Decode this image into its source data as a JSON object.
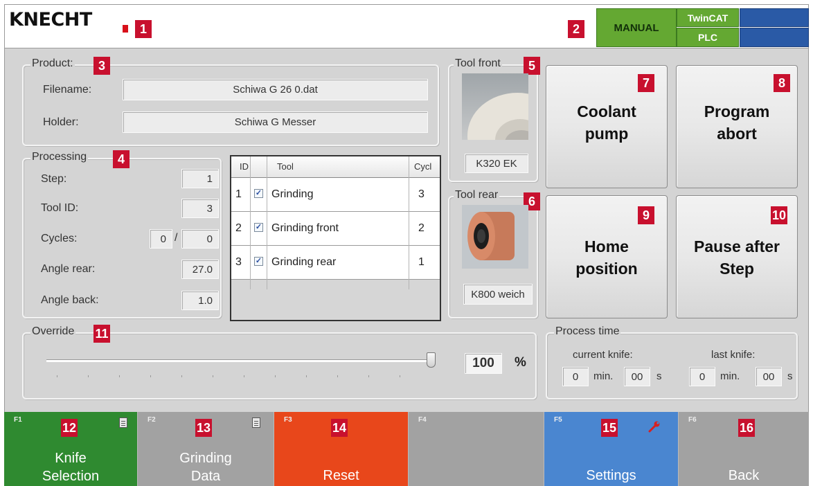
{
  "header": {
    "logo": "KNECHT",
    "mode": "MANUAL",
    "runtime": "TwinCAT",
    "controller": "PLC",
    "colors": {
      "ok": "#64a832",
      "status_blue": "#2a5aa6",
      "marker": "#c8102e"
    }
  },
  "markers": [
    "1",
    "2",
    "3",
    "4",
    "5",
    "6",
    "7",
    "8",
    "9",
    "10",
    "11",
    "12",
    "13",
    "14",
    "15",
    "16"
  ],
  "product": {
    "legend": "Product:",
    "filename_label": "Filename:",
    "filename_value": "Schiwa G 26 0.dat",
    "holder_label": "Holder:",
    "holder_value": "Schiwa G Messer"
  },
  "processing": {
    "legend": "Processing",
    "step_label": "Step:",
    "step_value": "1",
    "tool_id_label": "Tool ID:",
    "tool_id_value": "3",
    "cycles_label": "Cycles:",
    "cycles_current": "0",
    "cycles_sep": "/",
    "cycles_total": "0",
    "angle_rear_label": "Angle rear:",
    "angle_rear_value": "27.0",
    "angle_back_label": "Angle back:",
    "angle_back_value": "1.0"
  },
  "tool_table": {
    "headers": [
      "ID",
      "Tool",
      "Cycl"
    ],
    "rows": [
      {
        "id": "1",
        "checked": true,
        "tool": "Grinding",
        "cycles": "3"
      },
      {
        "id": "2",
        "checked": true,
        "tool": "Grinding front",
        "cycles": "2"
      },
      {
        "id": "3",
        "checked": true,
        "tool": "Grinding rear",
        "cycles": "1"
      }
    ]
  },
  "tool_front": {
    "legend": "Tool front",
    "name": "K320 EK"
  },
  "tool_rear": {
    "legend": "Tool rear",
    "name": "K800 weich"
  },
  "buttons": {
    "coolant_l1": "Coolant",
    "coolant_l2": "pump",
    "abort_l1": "Program",
    "abort_l2": "abort",
    "home_l1": "Home",
    "home_l2": "position",
    "pause_l1": "Pause after",
    "pause_l2": "Step"
  },
  "override": {
    "legend": "Override",
    "value": "100",
    "unit": "%",
    "level": 1.0
  },
  "process_time": {
    "legend": "Process time",
    "current_label": "current knife:",
    "last_label": "last knife:",
    "current_min": "0",
    "current_sec": "00",
    "last_min": "0",
    "last_sec": "00",
    "min_unit": "min.",
    "sec_unit": "s"
  },
  "fkeys": [
    {
      "key": "F1",
      "l1": "Knife",
      "l2": "Selection",
      "color": "#2f8a30"
    },
    {
      "key": "F2",
      "l1": "Grinding",
      "l2": "Data",
      "color": "#a2a2a2"
    },
    {
      "key": "F3",
      "l1": "Reset",
      "l2": "",
      "color": "#e8471b"
    },
    {
      "key": "F4",
      "l1": "",
      "l2": "",
      "color": "#a2a2a2"
    },
    {
      "key": "F5",
      "l1": "Settings",
      "l2": "",
      "color": "#4a86d0"
    },
    {
      "key": "F6",
      "l1": "Back",
      "l2": "",
      "color": "#a2a2a2"
    }
  ]
}
